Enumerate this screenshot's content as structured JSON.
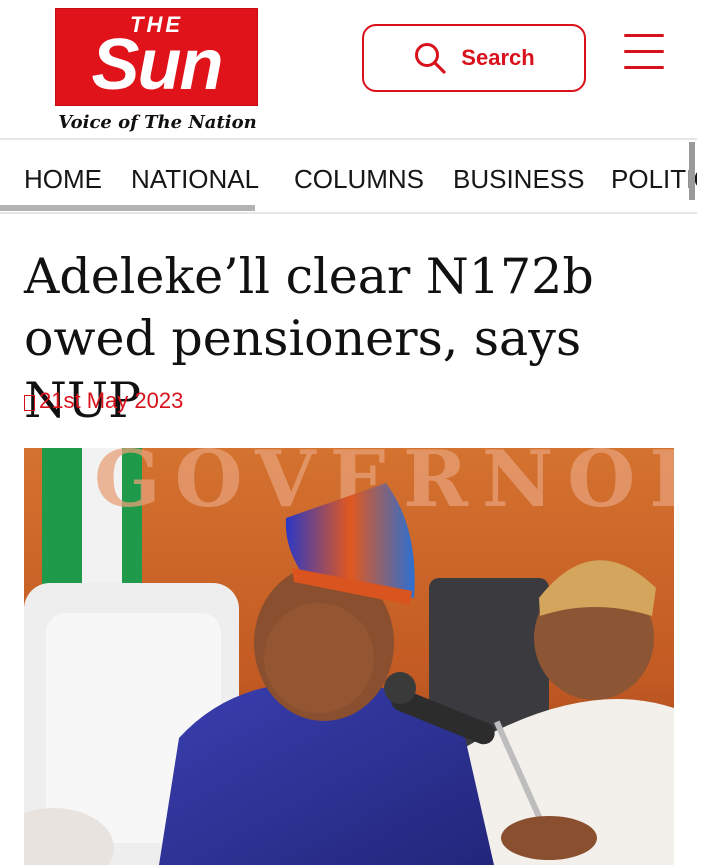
{
  "header": {
    "logo": {
      "the": "THE",
      "name": "Sun",
      "tagline": "Voice of The Nation"
    },
    "search_label": "Search",
    "search_icon": "search-icon",
    "menu_icon": "hamburger-menu-icon",
    "accent_color": "#d8111b"
  },
  "nav": {
    "items": [
      {
        "label": "HOME",
        "active": true
      },
      {
        "label": "NATIONAL"
      },
      {
        "label": "COLUMNS"
      },
      {
        "label": "BUSINESS"
      },
      {
        "label": "POLITICS"
      }
    ]
  },
  "article": {
    "headline": "Adeleke’ll clear N172b owed pensioners, says NUP",
    "date_icon": "calendar-icon",
    "date": "21st May 2023",
    "photo_background_text": "GOVERNOR"
  }
}
